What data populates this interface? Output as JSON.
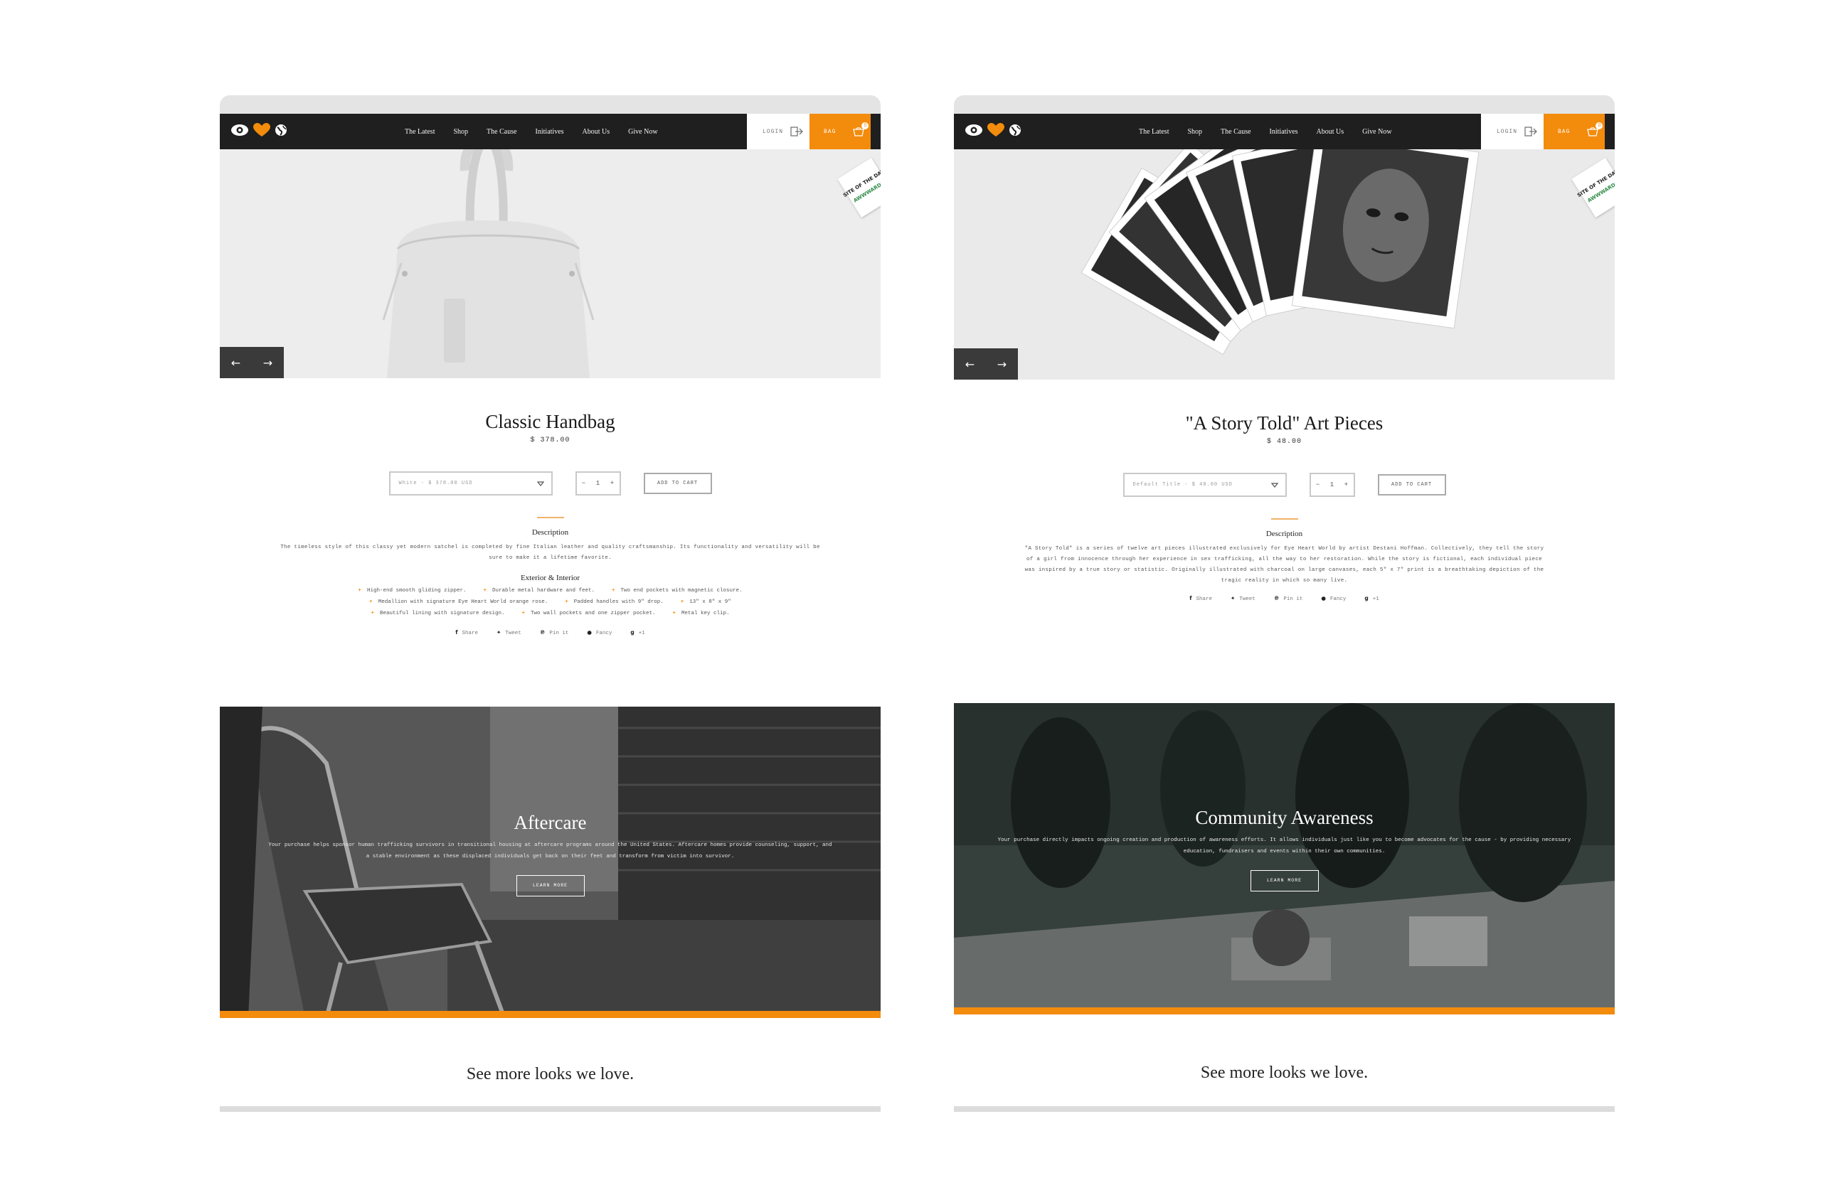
{
  "brand": {
    "accent_color": "#f38b0c",
    "logo_icons": [
      "eye-icon",
      "heart-icon",
      "globe-icon"
    ]
  },
  "nav": {
    "links": [
      "The Latest",
      "Shop",
      "The Cause",
      "Initiatives",
      "About Us",
      "Give Now"
    ],
    "login_label": "LOGIN",
    "bag_label": "BAG",
    "bag_count": "0"
  },
  "award": {
    "line1": "SITE OF THE DAY",
    "line2": "AWWWARDS"
  },
  "left_product": {
    "title": "Classic Handbag",
    "price": "$ 378.00",
    "variant": "White - $ 378.00 USD",
    "quantity": "1",
    "add_to_cart": "ADD TO CART",
    "description_heading": "Description",
    "description": "The timeless style of this classy yet modern satchel is completed by fine Italian leather and quality craftsmanship. Its functionality and versatility will be sure to make it a lifetime favorite.",
    "features_heading": "Exterior & Interior",
    "features": [
      "High-end smooth gliding zipper.",
      "Durable metal hardware and feet.",
      "Two end pockets with magnetic closure.",
      "Medallion with signature Eye Heart World orange rose.",
      "Padded handles with 9\" drop.",
      "13\" x 8\" x 9\"",
      "Beautiful lining with signature design.",
      "Two wall pockets and one zipper pocket.",
      "Metal key clip."
    ]
  },
  "right_product": {
    "title": "\"A Story Told\" Art Pieces",
    "price": "$ 48.00",
    "variant": "Default Title - $ 48.00 USD",
    "quantity": "1",
    "add_to_cart": "ADD TO CART",
    "description_heading": "Description",
    "description": "\"A Story Told\" is a series of twelve art pieces illustrated exclusively for Eye Heart World by artist Destani Hoffman. Collectively, they tell the story of a girl from innocence through her experience in sex trafficking, all the way to her restoration. While the story is fictional, each individual piece was inspired by a true story or statistic. Originally illustrated with charcoal on large canvases, each 5\" x 7\" print is a breathtaking depiction of the tragic reality in which so many live."
  },
  "share": [
    "Share",
    "Tweet",
    "Pin it",
    "Fancy",
    "+1"
  ],
  "share_icons": [
    "facebook-icon",
    "twitter-icon",
    "pinterest-icon",
    "fancy-icon",
    "google-plus-icon"
  ],
  "left_banner": {
    "title": "Aftercare",
    "text": "Your purchase helps sponsor human trafficking survivors in transitional housing at aftercare programs around the United States. Aftercare homes provide counseling, support, and a stable environment as these displaced individuals get back on their feet and transform from victim into survivor.",
    "button": "LEARN MORE"
  },
  "right_banner": {
    "title": "Community Awareness",
    "text": "Your purchase directly impacts ongoing creation and production of awareness efforts. It allows individuals just like you to become advocates for the cause - by providing necessary education, fundraisers and events within their own communities.",
    "button": "LEARN MORE"
  },
  "see_more": "See more looks we love."
}
